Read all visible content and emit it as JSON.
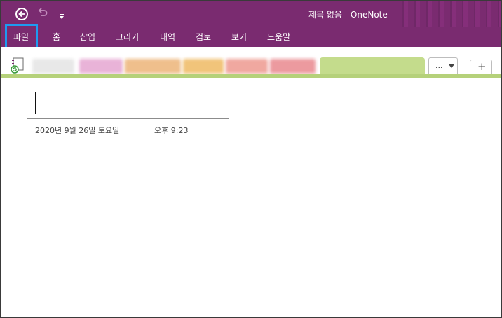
{
  "app": {
    "title": "제목 없음  -  OneNote",
    "accent_color": "#7a2b70",
    "focus_color": "#1e9bf0"
  },
  "quick_access": {
    "back_icon": "back-arrow-circle-icon",
    "undo_icon": "undo-icon",
    "customize_icon": "customize-dropdown-icon"
  },
  "ribbon": {
    "tabs": [
      "파일",
      "홈",
      "삽입",
      "그리기",
      "내역",
      "검토",
      "보기",
      "도움말"
    ]
  },
  "notebook_bar": {
    "notebook_icon": "notebook-sync-icon",
    "more_sections_label": "...",
    "add_section_label": "+"
  },
  "page": {
    "date": "2020년 9월 26일 토요일",
    "time": "오후 9:23"
  }
}
